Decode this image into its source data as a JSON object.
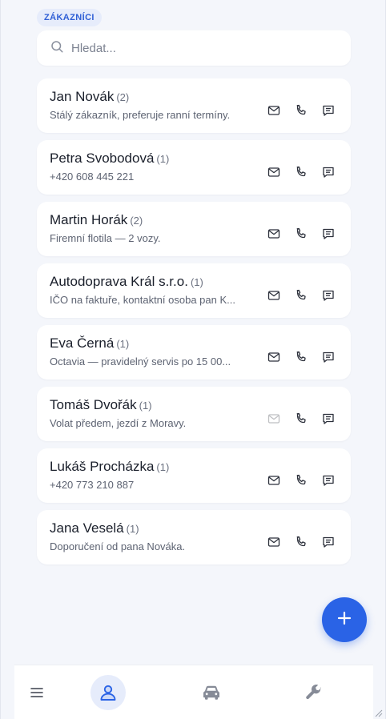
{
  "section": {
    "badge": "ZÁKAZNÍCI"
  },
  "search": {
    "placeholder": "Hledat..."
  },
  "customers": [
    {
      "name": "Jan Novák",
      "count": "(2)",
      "note": "Stálý zákazník, preferuje ranní termíny.",
      "email_enabled": true
    },
    {
      "name": "Petra Svobodová",
      "count": "(1)",
      "note": "+420 608 445 221",
      "email_enabled": true
    },
    {
      "name": "Martin Horák",
      "count": "(2)",
      "note": "Firemní flotila — 2 vozy.",
      "email_enabled": true
    },
    {
      "name": "Autodoprava Král s.r.o.",
      "count": "(1)",
      "note": "IČO na faktuře, kontaktní osoba pan K...",
      "email_enabled": true
    },
    {
      "name": "Eva Černá",
      "count": "(1)",
      "note": "Octavia — pravidelný servis po 15 00...",
      "email_enabled": true
    },
    {
      "name": "Tomáš Dvořák",
      "count": "(1)",
      "note": "Volat předem, jezdí z Moravy.",
      "email_enabled": false
    },
    {
      "name": "Lukáš Procházka",
      "count": "(1)",
      "note": "+420 773 210 887",
      "email_enabled": true
    },
    {
      "name": "Jana Veselá",
      "count": "(1)",
      "note": "Doporučení od pana Nováka.",
      "email_enabled": true
    }
  ],
  "icons": {
    "search": "search-icon",
    "email": "mail-icon",
    "phone": "phone-icon",
    "message": "message-icon",
    "add": "plus-icon",
    "menu": "menu-icon",
    "customers": "customers-icon",
    "vehicles": "car-icon",
    "service": "wrench-icon"
  },
  "colors": {
    "accent": "#2a63e6",
    "badge_bg": "#e6ecfb",
    "badge_text": "#2f5fd6",
    "background": "#f4f6fb"
  },
  "bottom_nav": {
    "active": "customers"
  }
}
